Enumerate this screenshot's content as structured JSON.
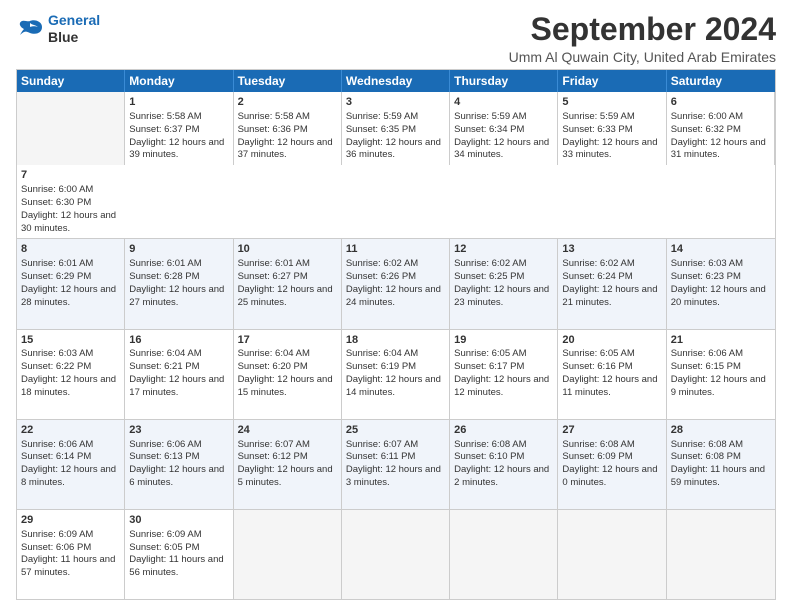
{
  "logo": {
    "line1": "General",
    "line2": "Blue"
  },
  "title": "September 2024",
  "subtitle": "Umm Al Quwain City, United Arab Emirates",
  "days": [
    "Sunday",
    "Monday",
    "Tuesday",
    "Wednesday",
    "Thursday",
    "Friday",
    "Saturday"
  ],
  "rows": [
    [
      {
        "day": "",
        "empty": true
      },
      {
        "day": "1",
        "rise": "5:58 AM",
        "set": "6:37 PM",
        "daylight": "Daylight: 12 hours and 39 minutes."
      },
      {
        "day": "2",
        "rise": "5:58 AM",
        "set": "6:36 PM",
        "daylight": "Daylight: 12 hours and 37 minutes."
      },
      {
        "day": "3",
        "rise": "5:59 AM",
        "set": "6:35 PM",
        "daylight": "Daylight: 12 hours and 36 minutes."
      },
      {
        "day": "4",
        "rise": "5:59 AM",
        "set": "6:34 PM",
        "daylight": "Daylight: 12 hours and 34 minutes."
      },
      {
        "day": "5",
        "rise": "5:59 AM",
        "set": "6:33 PM",
        "daylight": "Daylight: 12 hours and 33 minutes."
      },
      {
        "day": "6",
        "rise": "6:00 AM",
        "set": "6:32 PM",
        "daylight": "Daylight: 12 hours and 31 minutes."
      },
      {
        "day": "7",
        "rise": "6:00 AM",
        "set": "6:30 PM",
        "daylight": "Daylight: 12 hours and 30 minutes."
      }
    ],
    [
      {
        "day": "8",
        "rise": "6:01 AM",
        "set": "6:29 PM",
        "daylight": "Daylight: 12 hours and 28 minutes."
      },
      {
        "day": "9",
        "rise": "6:01 AM",
        "set": "6:28 PM",
        "daylight": "Daylight: 12 hours and 27 minutes."
      },
      {
        "day": "10",
        "rise": "6:01 AM",
        "set": "6:27 PM",
        "daylight": "Daylight: 12 hours and 25 minutes."
      },
      {
        "day": "11",
        "rise": "6:02 AM",
        "set": "6:26 PM",
        "daylight": "Daylight: 12 hours and 24 minutes."
      },
      {
        "day": "12",
        "rise": "6:02 AM",
        "set": "6:25 PM",
        "daylight": "Daylight: 12 hours and 23 minutes."
      },
      {
        "day": "13",
        "rise": "6:02 AM",
        "set": "6:24 PM",
        "daylight": "Daylight: 12 hours and 21 minutes."
      },
      {
        "day": "14",
        "rise": "6:03 AM",
        "set": "6:23 PM",
        "daylight": "Daylight: 12 hours and 20 minutes."
      }
    ],
    [
      {
        "day": "15",
        "rise": "6:03 AM",
        "set": "6:22 PM",
        "daylight": "Daylight: 12 hours and 18 minutes."
      },
      {
        "day": "16",
        "rise": "6:04 AM",
        "set": "6:21 PM",
        "daylight": "Daylight: 12 hours and 17 minutes."
      },
      {
        "day": "17",
        "rise": "6:04 AM",
        "set": "6:20 PM",
        "daylight": "Daylight: 12 hours and 15 minutes."
      },
      {
        "day": "18",
        "rise": "6:04 AM",
        "set": "6:19 PM",
        "daylight": "Daylight: 12 hours and 14 minutes."
      },
      {
        "day": "19",
        "rise": "6:05 AM",
        "set": "6:17 PM",
        "daylight": "Daylight: 12 hours and 12 minutes."
      },
      {
        "day": "20",
        "rise": "6:05 AM",
        "set": "6:16 PM",
        "daylight": "Daylight: 12 hours and 11 minutes."
      },
      {
        "day": "21",
        "rise": "6:06 AM",
        "set": "6:15 PM",
        "daylight": "Daylight: 12 hours and 9 minutes."
      }
    ],
    [
      {
        "day": "22",
        "rise": "6:06 AM",
        "set": "6:14 PM",
        "daylight": "Daylight: 12 hours and 8 minutes."
      },
      {
        "day": "23",
        "rise": "6:06 AM",
        "set": "6:13 PM",
        "daylight": "Daylight: 12 hours and 6 minutes."
      },
      {
        "day": "24",
        "rise": "6:07 AM",
        "set": "6:12 PM",
        "daylight": "Daylight: 12 hours and 5 minutes."
      },
      {
        "day": "25",
        "rise": "6:07 AM",
        "set": "6:11 PM",
        "daylight": "Daylight: 12 hours and 3 minutes."
      },
      {
        "day": "26",
        "rise": "6:08 AM",
        "set": "6:10 PM",
        "daylight": "Daylight: 12 hours and 2 minutes."
      },
      {
        "day": "27",
        "rise": "6:08 AM",
        "set": "6:09 PM",
        "daylight": "Daylight: 12 hours and 0 minutes."
      },
      {
        "day": "28",
        "rise": "6:08 AM",
        "set": "6:08 PM",
        "daylight": "Daylight: 11 hours and 59 minutes."
      }
    ],
    [
      {
        "day": "29",
        "rise": "6:09 AM",
        "set": "6:06 PM",
        "daylight": "Daylight: 11 hours and 57 minutes."
      },
      {
        "day": "30",
        "rise": "6:09 AM",
        "set": "6:05 PM",
        "daylight": "Daylight: 11 hours and 56 minutes."
      },
      {
        "day": "",
        "empty": true
      },
      {
        "day": "",
        "empty": true
      },
      {
        "day": "",
        "empty": true
      },
      {
        "day": "",
        "empty": true
      },
      {
        "day": "",
        "empty": true
      }
    ]
  ]
}
